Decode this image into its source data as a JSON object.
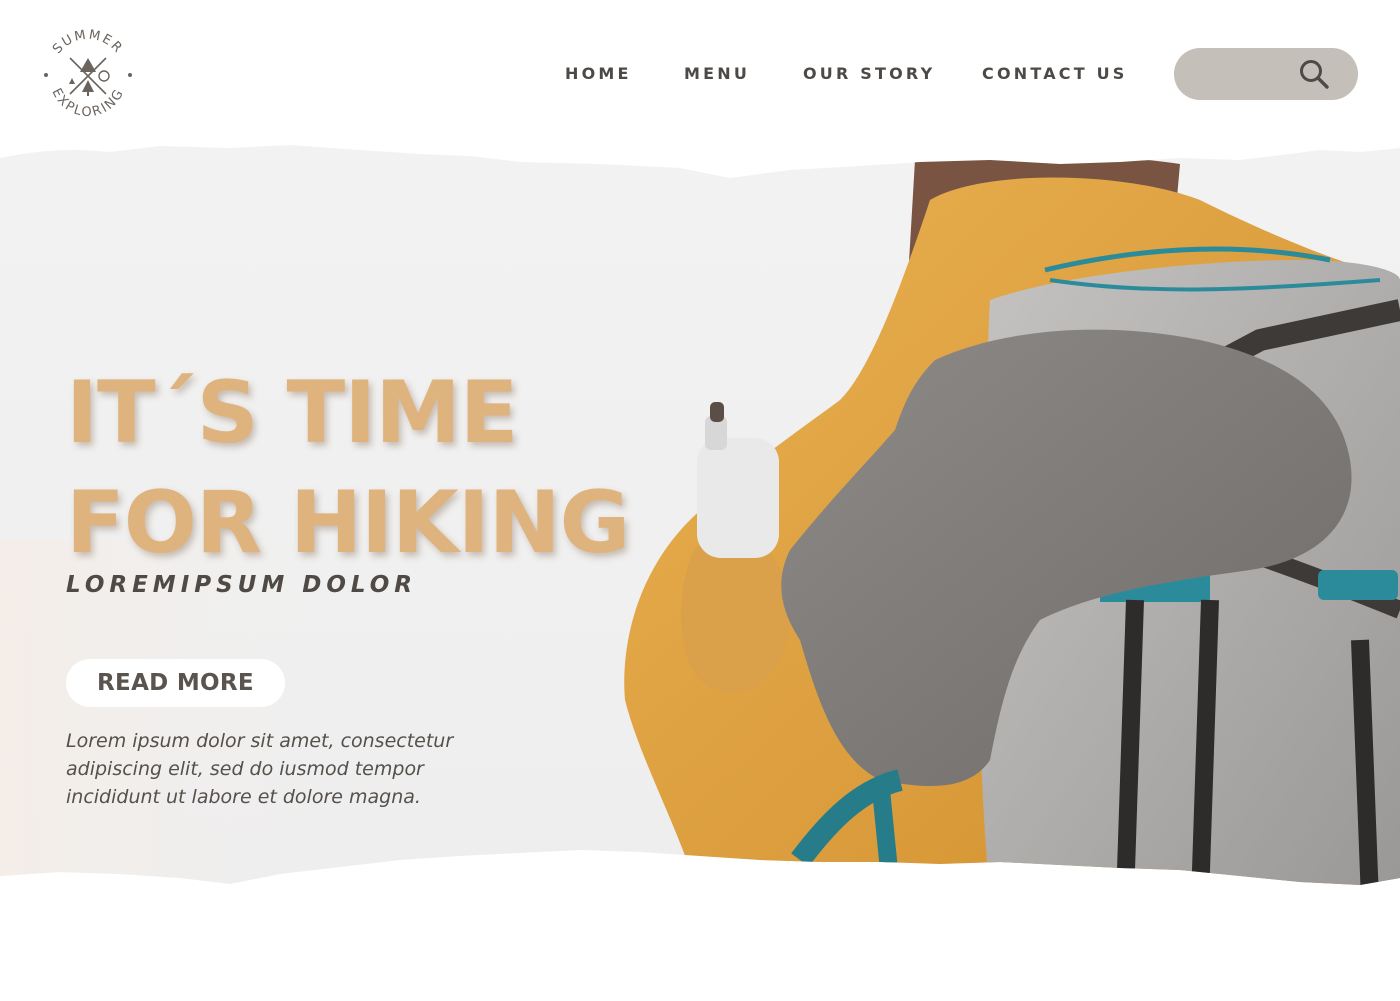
{
  "brand": {
    "logo_top_text": "SUMMER",
    "logo_bottom_text": "EXPLORING"
  },
  "nav": {
    "items": [
      {
        "label": "HOME"
      },
      {
        "label": "MENU"
      },
      {
        "label": "OUR STORY"
      },
      {
        "label": "CONTACT US"
      }
    ]
  },
  "search": {
    "value": "",
    "placeholder": ""
  },
  "hero": {
    "headline_line1": "IT´S TIME",
    "headline_line2": "FOR HIKING",
    "subheadline": "LOREMIPSUM DOLOR",
    "cta_label": "READ MORE",
    "body": "Lorem ipsum dolor sit amet, consectetur adipiscing elit, sed do iusmod tempor incididunt ut labore et dolore magna."
  },
  "colors": {
    "accent": "#dfb37e",
    "nav_text": "#4d4945",
    "search_bg": "#c4bfb9",
    "jacket": "#e3a444",
    "backpack": "#b2b0ae",
    "strap": "#2c8b9b"
  },
  "icons": {
    "search": "search-icon",
    "logo": "tent-compass-logo-icon"
  }
}
